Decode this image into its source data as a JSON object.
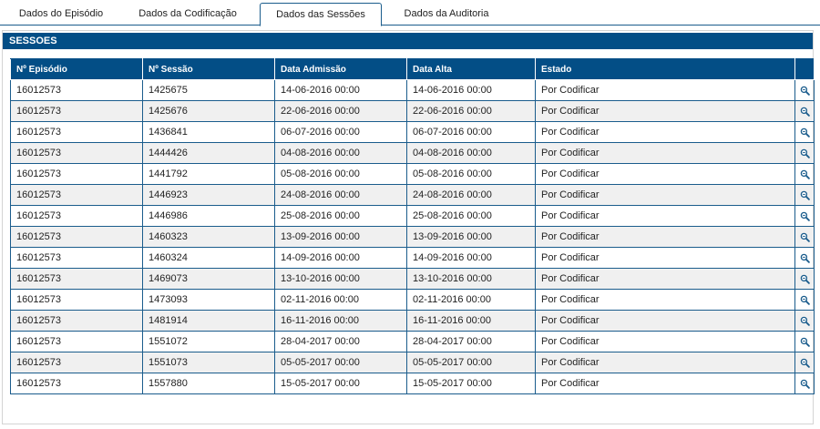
{
  "tabs": [
    {
      "label": "Dados do Episódio"
    },
    {
      "label": "Dados da Codificação"
    },
    {
      "label": "Dados das Sessões"
    },
    {
      "label": "Dados da Auditoria"
    }
  ],
  "panel": {
    "title": "SESSOES"
  },
  "table": {
    "columns": [
      "Nº Episódio",
      "Nº Sessão",
      "Data Admissão",
      "Data Alta",
      "Estado",
      ""
    ],
    "rows": [
      [
        "16012573",
        "1425675",
        "14-06-2016 00:00",
        "14-06-2016 00:00",
        "Por Codificar"
      ],
      [
        "16012573",
        "1425676",
        "22-06-2016 00:00",
        "22-06-2016 00:00",
        "Por Codificar"
      ],
      [
        "16012573",
        "1436841",
        "06-07-2016 00:00",
        "06-07-2016 00:00",
        "Por Codificar"
      ],
      [
        "16012573",
        "1444426",
        "04-08-2016 00:00",
        "04-08-2016 00:00",
        "Por Codificar"
      ],
      [
        "16012573",
        "1441792",
        "05-08-2016 00:00",
        "05-08-2016 00:00",
        "Por Codificar"
      ],
      [
        "16012573",
        "1446923",
        "24-08-2016 00:00",
        "24-08-2016 00:00",
        "Por Codificar"
      ],
      [
        "16012573",
        "1446986",
        "25-08-2016 00:00",
        "25-08-2016 00:00",
        "Por Codificar"
      ],
      [
        "16012573",
        "1460323",
        "13-09-2016 00:00",
        "13-09-2016 00:00",
        "Por Codificar"
      ],
      [
        "16012573",
        "1460324",
        "14-09-2016 00:00",
        "14-09-2016 00:00",
        "Por Codificar"
      ],
      [
        "16012573",
        "1469073",
        "13-10-2016 00:00",
        "13-10-2016 00:00",
        "Por Codificar"
      ],
      [
        "16012573",
        "1473093",
        "02-11-2016 00:00",
        "02-11-2016 00:00",
        "Por Codificar"
      ],
      [
        "16012573",
        "1481914",
        "16-11-2016 00:00",
        "16-11-2016 00:00",
        "Por Codificar"
      ],
      [
        "16012573",
        "1551072",
        "28-04-2017 00:00",
        "28-04-2017 00:00",
        "Por Codificar"
      ],
      [
        "16012573",
        "1551073",
        "05-05-2017 00:00",
        "05-05-2017 00:00",
        "Por Codificar"
      ],
      [
        "16012573",
        "1557880",
        "15-05-2017 00:00",
        "15-05-2017 00:00",
        "Por Codificar"
      ]
    ],
    "row_action_icon": "zoom-icon"
  },
  "colors": {
    "header_blue": "#034e86",
    "border_blue": "#1a5c8c",
    "alt_row": "#f0f0f0"
  }
}
